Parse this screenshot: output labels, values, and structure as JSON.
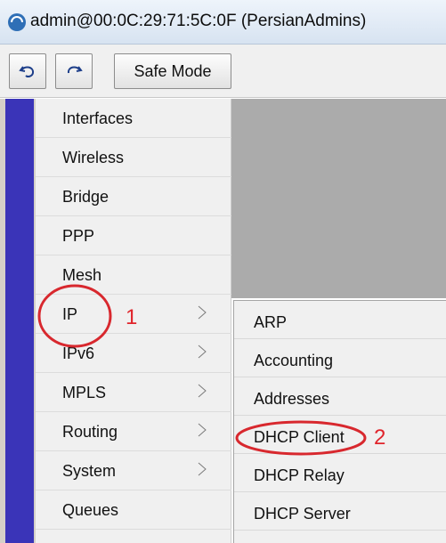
{
  "window": {
    "title": "admin@00:0C:29:71:5C:0F (PersianAdmins)"
  },
  "toolbar": {
    "undo_icon": "undo-icon",
    "redo_icon": "redo-icon",
    "safe_mode_label": "Safe Mode"
  },
  "menu": {
    "items": [
      {
        "label": "Interfaces",
        "has_submenu": false
      },
      {
        "label": "Wireless",
        "has_submenu": false
      },
      {
        "label": "Bridge",
        "has_submenu": false
      },
      {
        "label": "PPP",
        "has_submenu": false
      },
      {
        "label": "Mesh",
        "has_submenu": false
      },
      {
        "label": "IP",
        "has_submenu": true
      },
      {
        "label": "IPv6",
        "has_submenu": true
      },
      {
        "label": "MPLS",
        "has_submenu": true
      },
      {
        "label": "Routing",
        "has_submenu": true
      },
      {
        "label": "System",
        "has_submenu": true
      },
      {
        "label": "Queues",
        "has_submenu": false
      }
    ]
  },
  "submenu": {
    "items": [
      {
        "label": "ARP"
      },
      {
        "label": "Accounting"
      },
      {
        "label": "Addresses"
      },
      {
        "label": "DHCP Client"
      },
      {
        "label": "DHCP Relay"
      },
      {
        "label": "DHCP Server"
      }
    ]
  },
  "annotations": {
    "step1": "1",
    "step2": "2",
    "color": "#e0242b"
  }
}
